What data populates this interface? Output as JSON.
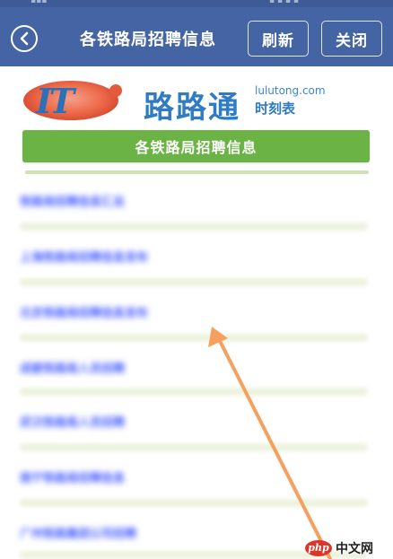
{
  "header": {
    "title": "各铁路局招聘信息",
    "refresh_label": "刷新",
    "close_label": "关闭",
    "back_icon": "back-arrow-icon"
  },
  "logo": {
    "mark": "IT",
    "name": "路路通",
    "domain": "lulutong.com",
    "subtitle": "时刻表"
  },
  "banner": {
    "title": "各铁路局招聘信息"
  },
  "list": {
    "items": [
      {
        "label": "铁路局招聘信息汇总"
      },
      {
        "label": "上海铁路局招聘信息发布"
      },
      {
        "label": "北京铁路局招聘信息发布"
      },
      {
        "label": "成都铁路局人员招聘"
      },
      {
        "label": "武汉铁路局人员招聘"
      },
      {
        "label": "南宁铁路局招聘信息"
      },
      {
        "label": "广州铁路集团公司招聘"
      }
    ]
  },
  "watermark": {
    "badge": "php",
    "text": "中文网"
  },
  "colors": {
    "header_bg": "#4464a3",
    "banner_green": "#6ab344",
    "link_blue": "#4a60ff",
    "arrow_orange": "#f5a05e"
  }
}
